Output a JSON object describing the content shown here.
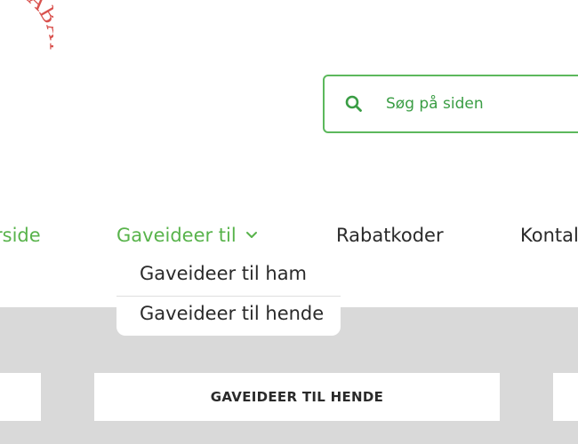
{
  "logo": {
    "text": "RABAT",
    "color": "#d9534f"
  },
  "search": {
    "placeholder": "Søg på siden",
    "icon": "search-icon"
  },
  "nav": {
    "items": [
      {
        "label": "Forside",
        "visible_label": "rside"
      },
      {
        "label": "Gaveideer til",
        "icon": "chevron-down-icon"
      },
      {
        "label": "Rabatkoder"
      },
      {
        "label": "Kontakt",
        "visible_label": "Kontal"
      }
    ]
  },
  "dropdown": {
    "items": [
      {
        "label": "Gaveideer til ham"
      },
      {
        "label": "Gaveideer til hende"
      }
    ]
  },
  "cards": {
    "middle_label": "GAVEIDEER TIL HENDE"
  },
  "colors": {
    "accent": "#58b34b",
    "text": "#2a2a2a",
    "grey": "#d9d9d9"
  }
}
